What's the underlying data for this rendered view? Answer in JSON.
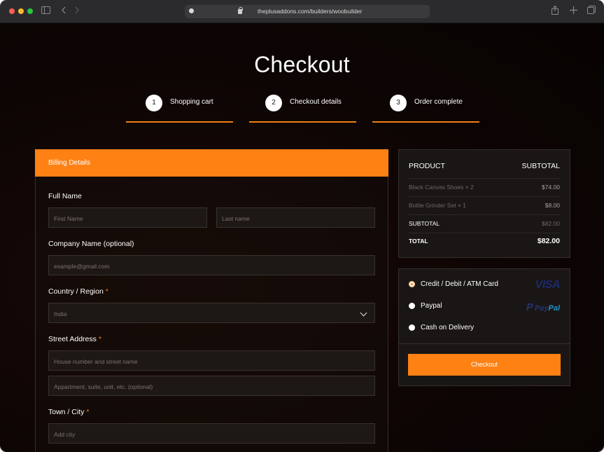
{
  "browser": {
    "url": "theplusaddons.com/builders/woobuilder"
  },
  "page": {
    "title": "Checkout"
  },
  "steps": [
    {
      "number": "1",
      "label": "Shopping cart"
    },
    {
      "number": "2",
      "label": "Checkout details"
    },
    {
      "number": "3",
      "label": "Order complete"
    }
  ],
  "billing": {
    "header": "Billing Details",
    "full_name_label": "Full Name",
    "first_name_placeholder": "First Name",
    "last_name_placeholder": "Last name",
    "company_label": "Company Name (optional)",
    "company_placeholder": "example@gmail.com",
    "country_label": "Country / Region",
    "country_value": "India",
    "street_label": "Street Address",
    "street_placeholder_1": "House number and street name",
    "street_placeholder_2": "Appartment, suite, unit, etc. (optional)",
    "city_label": "Town / City",
    "city_placeholder": "Add city",
    "required_marker": "*"
  },
  "order_summary": {
    "product_header": "PRODUCT",
    "subtotal_header": "SUBTOTAL",
    "items": [
      {
        "name": "Black Canvas Shoes",
        "qty": "× 2",
        "price": "$74.00"
      },
      {
        "name": "Bottle Grinder Set",
        "qty": "× 1",
        "price": "$8.00"
      }
    ],
    "subtotal_label": "SUBTOTAL",
    "subtotal_value": "$82.00",
    "total_label": "TOTAL",
    "total_value": "$82.00"
  },
  "payment": {
    "options": [
      {
        "label": "Credit / Debit / ATM Card",
        "selected": true,
        "logo": "VISA"
      },
      {
        "label": "Paypal",
        "selected": false,
        "logo_part1": "Pay",
        "logo_part2": "Pal"
      },
      {
        "label": "Cash on Delivery",
        "selected": false
      }
    ],
    "checkout_button": "Checkout"
  },
  "colors": {
    "accent": "#fe8114",
    "background": "#0b0605",
    "panel": "#1a1615"
  }
}
